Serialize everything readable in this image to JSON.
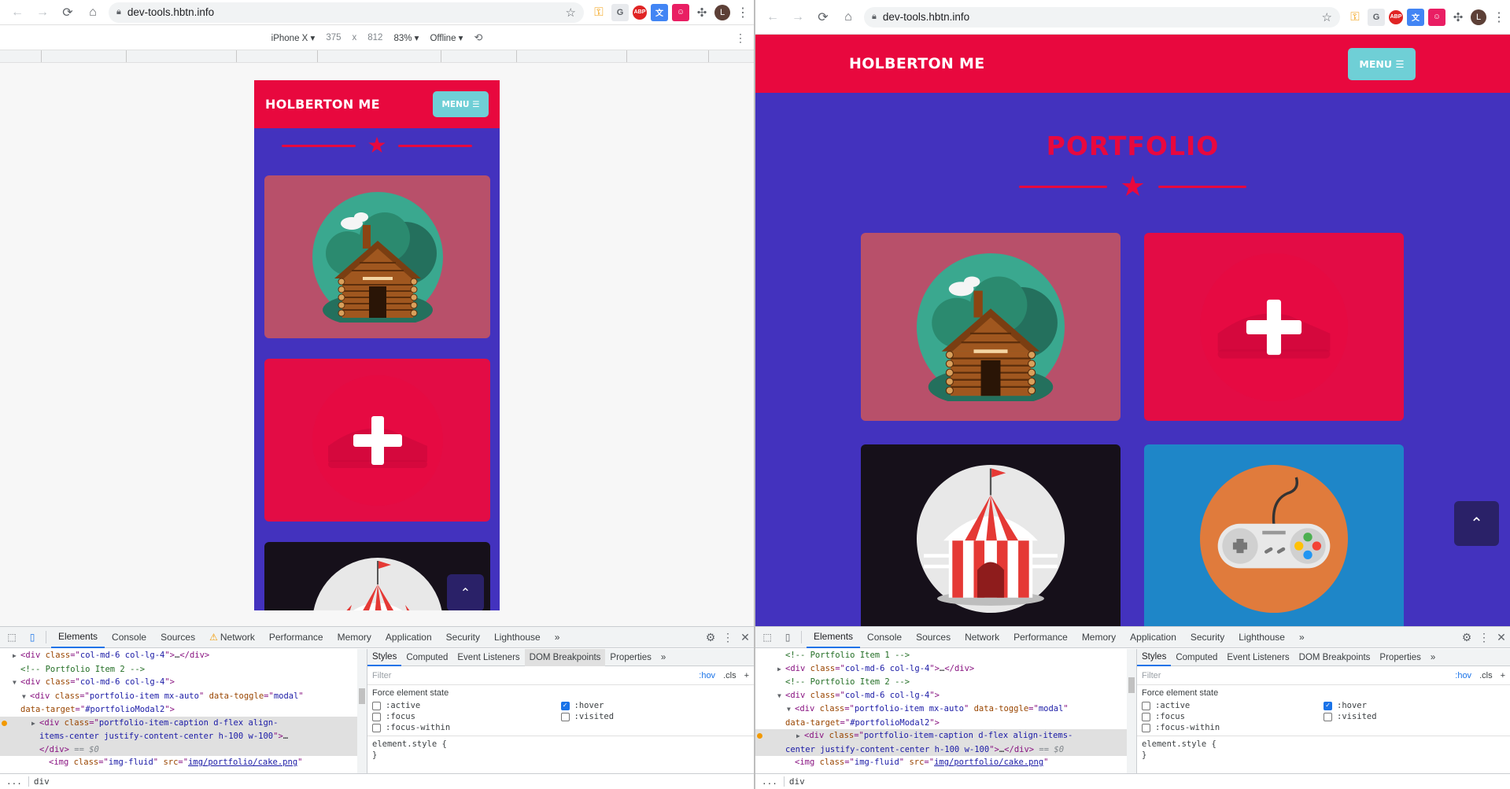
{
  "left": {
    "url": "dev-tools.hbtn.info",
    "device": {
      "name": "iPhone X",
      "width": "375",
      "times": "x",
      "height": "812",
      "zoom": "83%",
      "network": "Offline"
    },
    "site": {
      "brand": "HOLBERTON ME",
      "menu_label": "MENU",
      "scroll_top_glyph": "⌃"
    },
    "devtools": {
      "tabs": [
        "Elements",
        "Console",
        "Sources",
        "Network",
        "Performance",
        "Memory",
        "Application",
        "Security",
        "Lighthouse"
      ],
      "active_tab": "Elements",
      "more": "»",
      "styles_tabs": [
        "Styles",
        "Computed",
        "Event Listeners",
        "DOM Breakpoints",
        "Properties"
      ],
      "filter_placeholder": "Filter",
      "hov": ":hov",
      "cls": ".cls",
      "plus": "+",
      "force_title": "Force element state",
      "states": [
        ":active",
        ":focus",
        ":focus-within"
      ],
      "states_right": [
        ":hover",
        ":visited"
      ],
      "element_style_open": "element.style {",
      "element_style_close": "}",
      "crumb_dots": "...",
      "crumb": "div"
    }
  },
  "right": {
    "url": "dev-tools.hbtn.info",
    "site": {
      "brand": "HOLBERTON ME",
      "menu_label": "MENU",
      "heading": "PORTFOLIO",
      "scroll_top_glyph": "⌃"
    },
    "devtools": {
      "tabs": [
        "Elements",
        "Console",
        "Sources",
        "Network",
        "Performance",
        "Memory",
        "Application",
        "Security",
        "Lighthouse"
      ],
      "active_tab": "Elements",
      "more": "»",
      "styles_tabs": [
        "Styles",
        "Computed",
        "Event Listeners",
        "DOM Breakpoints",
        "Properties"
      ],
      "filter_placeholder": "Filter",
      "hov": ":hov",
      "cls": ".cls",
      "plus": "+",
      "force_title": "Force element state",
      "states": [
        ":active",
        ":focus",
        ":focus-within"
      ],
      "states_right": [
        ":hover",
        ":visited"
      ],
      "element_style_open": "element.style {",
      "element_style_close": "}",
      "crumb_dots": "...",
      "crumb": "div"
    }
  },
  "dom_left": [
    {
      "indent": 1,
      "tri": "▶",
      "parts": [
        [
          "tag",
          "<div "
        ],
        [
          "attr",
          "class"
        ],
        [
          "tag",
          "=\""
        ],
        [
          "val",
          "col-md-6 col-lg-4"
        ],
        [
          "tag",
          "\">"
        ],
        [
          "plain",
          "…"
        ],
        [
          "tag",
          "</div>"
        ]
      ]
    },
    {
      "indent": 1,
      "tri": "",
      "parts": [
        [
          "cmt",
          "<!-- Portfolio Item 2 -->"
        ]
      ]
    },
    {
      "indent": 1,
      "tri": "▼",
      "parts": [
        [
          "tag",
          "<div "
        ],
        [
          "attr",
          "class"
        ],
        [
          "tag",
          "=\""
        ],
        [
          "val",
          "col-md-6 col-lg-4"
        ],
        [
          "tag",
          "\">"
        ]
      ]
    },
    {
      "indent": 2,
      "tri": "▼",
      "parts": [
        [
          "tag",
          "<div "
        ],
        [
          "attr",
          "class"
        ],
        [
          "tag",
          "=\""
        ],
        [
          "val",
          "portfolio-item mx-auto"
        ],
        [
          "tag",
          "\" "
        ],
        [
          "attr",
          "data-toggle"
        ],
        [
          "tag",
          "=\""
        ],
        [
          "val",
          "modal"
        ],
        [
          "tag",
          "\""
        ]
      ]
    },
    {
      "indent": 1,
      "tri": "",
      "parts": [
        [
          "attr",
          "data-target"
        ],
        [
          "tag",
          "=\""
        ],
        [
          "val",
          "#portfolioModal2"
        ],
        [
          "tag",
          "\">"
        ]
      ]
    },
    {
      "indent": 3,
      "tri": "▶",
      "sel": true,
      "parts": [
        [
          "tag",
          "<div "
        ],
        [
          "attr",
          "class"
        ],
        [
          "tag",
          "=\""
        ],
        [
          "val",
          "portfolio-item-caption d-flex align-"
        ]
      ]
    },
    {
      "indent": 3,
      "tri": "",
      "sel": true,
      "parts": [
        [
          "val",
          "items-center justify-content-center h-100 w-100"
        ],
        [
          "tag",
          "\">"
        ],
        [
          "plain",
          "…"
        ]
      ]
    },
    {
      "indent": 3,
      "tri": "",
      "sel": true,
      "parts": [
        [
          "tag",
          "</div>"
        ],
        [
          "muted",
          " == $0"
        ]
      ]
    },
    {
      "indent": 4,
      "tri": "",
      "parts": [
        [
          "tag",
          "<img "
        ],
        [
          "attr",
          "class"
        ],
        [
          "tag",
          "=\""
        ],
        [
          "val",
          "img-fluid"
        ],
        [
          "tag",
          "\" "
        ],
        [
          "attr",
          "src"
        ],
        [
          "tag",
          "=\""
        ],
        [
          "link",
          "img/portfolio/cake.png"
        ],
        [
          "tag",
          "\""
        ]
      ]
    }
  ],
  "dom_right": [
    {
      "indent": 2,
      "tri": "",
      "parts": [
        [
          "cmt",
          "<!-- Portfolio Item 1 -->"
        ]
      ]
    },
    {
      "indent": 2,
      "tri": "▶",
      "parts": [
        [
          "tag",
          "<div "
        ],
        [
          "attr",
          "class"
        ],
        [
          "tag",
          "=\""
        ],
        [
          "val",
          "col-md-6 col-lg-4"
        ],
        [
          "tag",
          "\">"
        ],
        [
          "plain",
          "…"
        ],
        [
          "tag",
          "</div>"
        ]
      ]
    },
    {
      "indent": 2,
      "tri": "",
      "parts": [
        [
          "cmt",
          "<!-- Portfolio Item 2 -->"
        ]
      ]
    },
    {
      "indent": 2,
      "tri": "▼",
      "parts": [
        [
          "tag",
          "<div "
        ],
        [
          "attr",
          "class"
        ],
        [
          "tag",
          "=\""
        ],
        [
          "val",
          "col-md-6 col-lg-4"
        ],
        [
          "tag",
          "\">"
        ]
      ]
    },
    {
      "indent": 3,
      "tri": "▼",
      "parts": [
        [
          "tag",
          "<div "
        ],
        [
          "attr",
          "class"
        ],
        [
          "tag",
          "=\""
        ],
        [
          "val",
          "portfolio-item mx-auto"
        ],
        [
          "tag",
          "\" "
        ],
        [
          "attr",
          "data-toggle"
        ],
        [
          "tag",
          "=\""
        ],
        [
          "val",
          "modal"
        ],
        [
          "tag",
          "\""
        ]
      ]
    },
    {
      "indent": 2,
      "tri": "",
      "parts": [
        [
          "attr",
          "data-target"
        ],
        [
          "tag",
          "=\""
        ],
        [
          "val",
          "#portfolioModal2"
        ],
        [
          "tag",
          "\">"
        ]
      ]
    },
    {
      "indent": 4,
      "tri": "▶",
      "sel": true,
      "parts": [
        [
          "tag",
          "<div "
        ],
        [
          "attr",
          "class"
        ],
        [
          "tag",
          "=\""
        ],
        [
          "val",
          "portfolio-item-caption d-flex align-items-"
        ]
      ]
    },
    {
      "indent": 2,
      "tri": "",
      "sel": true,
      "parts": [
        [
          "val",
          "center justify-content-center h-100 w-100"
        ],
        [
          "tag",
          "\">"
        ],
        [
          "plain",
          "…"
        ],
        [
          "tag",
          "</div>"
        ],
        [
          "muted",
          " == $0"
        ]
      ]
    },
    {
      "indent": 3,
      "tri": "",
      "parts": [
        [
          "tag",
          "<img "
        ],
        [
          "attr",
          "class"
        ],
        [
          "tag",
          "=\""
        ],
        [
          "val",
          "img-fluid"
        ],
        [
          "tag",
          "\" "
        ],
        [
          "attr",
          "src"
        ],
        [
          "tag",
          "=\""
        ],
        [
          "link",
          "img/portfolio/cake.png"
        ],
        [
          "tag",
          "\""
        ]
      ]
    }
  ],
  "colors": {
    "nav_red": "#e8083e",
    "site_purple": "#4332be",
    "menu_teal": "#6fcfd6",
    "cabin_tile": "#b8506a",
    "cake_tile": "#e30c45",
    "circus_tile": "#16101a",
    "game_tile": "#1e86c8"
  },
  "icons": [
    "back-arrow-icon",
    "forward-arrow-icon",
    "reload-icon",
    "home-icon",
    "lock-icon",
    "bookmark-star-icon",
    "key-extension-icon",
    "google-extension-icon",
    "adblock-icon",
    "translate-icon",
    "face-extension-icon",
    "extensions-puzzle-icon",
    "kebab-menu-icon"
  ]
}
